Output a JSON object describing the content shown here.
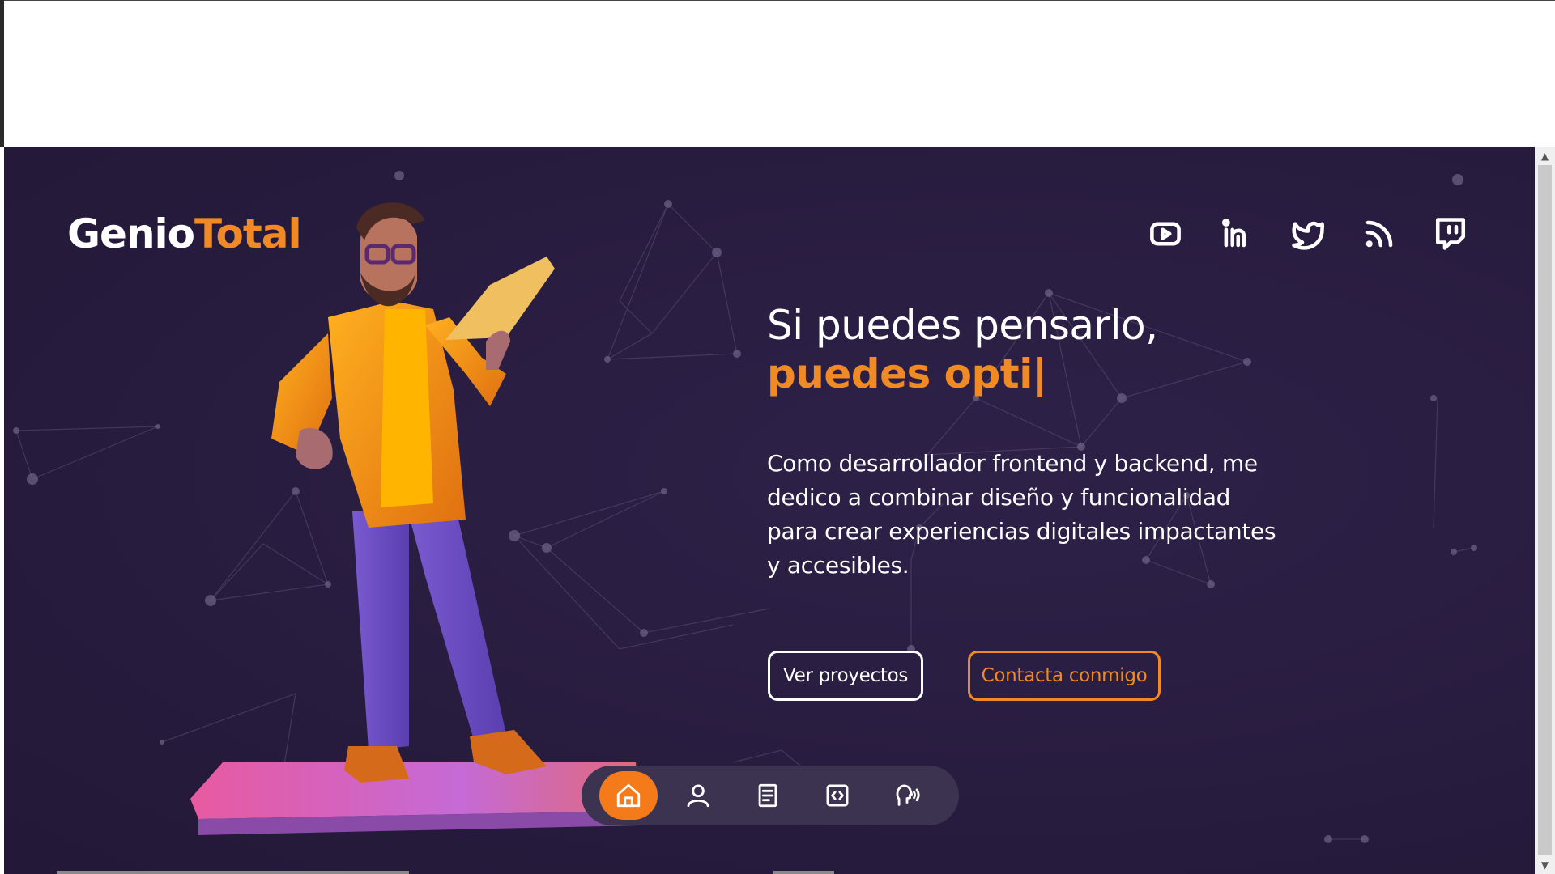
{
  "brand": {
    "part1": "Genio",
    "part2": "Total"
  },
  "social_links": [
    "youtube-icon",
    "linkedin-icon",
    "twitter-icon",
    "rss-icon",
    "twitch-icon"
  ],
  "hero": {
    "headline_line1": "Si puedes pensarlo,",
    "headline_line2": "puedes opti",
    "cursor": "|",
    "description": "Como desarrollador frontend y backend, me dedico a combinar diseño y funcionalidad para crear experiencias digitales impactantes y accesibles.",
    "primary_button": "Ver proyectos",
    "secondary_button": "Contacta conmigo"
  },
  "bottom_nav": {
    "items": [
      "home-icon",
      "user-icon",
      "book-icon",
      "code-icon",
      "speech-icon"
    ],
    "active_index": 0
  },
  "colors": {
    "background": "#281c3f",
    "accent": "#f08a24",
    "nav_background": "#3b3350"
  }
}
